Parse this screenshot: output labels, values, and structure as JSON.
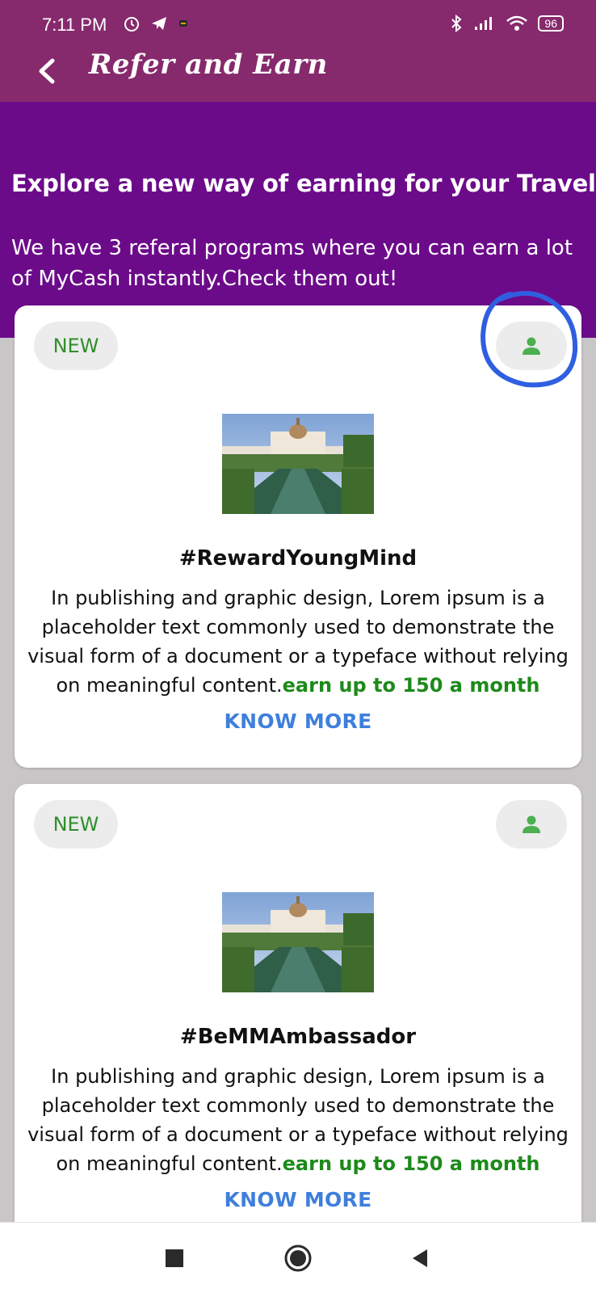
{
  "status_bar": {
    "time": "7:11 PM",
    "battery": "96"
  },
  "app_bar": {
    "title": "Refer and Earn"
  },
  "hero": {
    "heading": "Explore a new way of earning for your Travel",
    "subtext": "We have 3 referal programs where you can earn a lot of MyCash instantly.Check them out!"
  },
  "cards": [
    {
      "badge": "NEW",
      "title": "#RewardYoungMind",
      "description": "In publishing and graphic design, Lorem ipsum is a placeholder text commonly used to demonstrate the visual form of a document or a typeface without relying on meaningful content.",
      "earn_text": "earn up to 150 a month",
      "action": "KNOW MORE"
    },
    {
      "badge": "NEW",
      "title": "#BeMMAmbassador",
      "description": "In publishing and graphic design, Lorem ipsum is a placeholder text commonly used to demonstrate the visual form of a document or a typeface without relying on meaningful content.",
      "earn_text": "earn up to 150 a month",
      "action": "KNOW MORE"
    }
  ],
  "colors": {
    "app_bar": "#862a6d",
    "hero": "#6c0b8a",
    "badge_text": "#2f8f2a",
    "earn_text": "#1d8a1a",
    "link": "#3f7fdc",
    "annotation": "#2f5fe0"
  },
  "icons": [
    "back-arrow-icon",
    "person-icon",
    "stop-square-icon",
    "home-circle-icon",
    "back-triangle-icon"
  ]
}
